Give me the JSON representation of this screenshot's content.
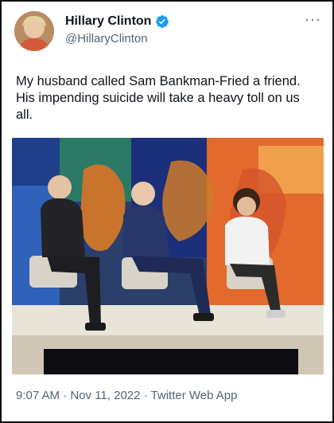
{
  "tweet": {
    "display_name": "Hillary Clinton",
    "handle": "@HillaryClinton",
    "verified": true,
    "more_icon": "more-options-icon",
    "text": "My husband called Sam Bankman-Fried a friend. His impending suicide will take a heavy toll on us all.",
    "media_description_icon": "photo",
    "meta": {
      "time": "9:07 AM",
      "separator": "·",
      "date": "Nov 11, 2022",
      "source": "Twitter Web App",
      "full": "9:07 AM · Nov 11, 2022 · Twitter Web App"
    }
  },
  "colors": {
    "verified_blue": "#1d9bf0",
    "text_primary": "#0f1419",
    "text_secondary": "#536471"
  }
}
